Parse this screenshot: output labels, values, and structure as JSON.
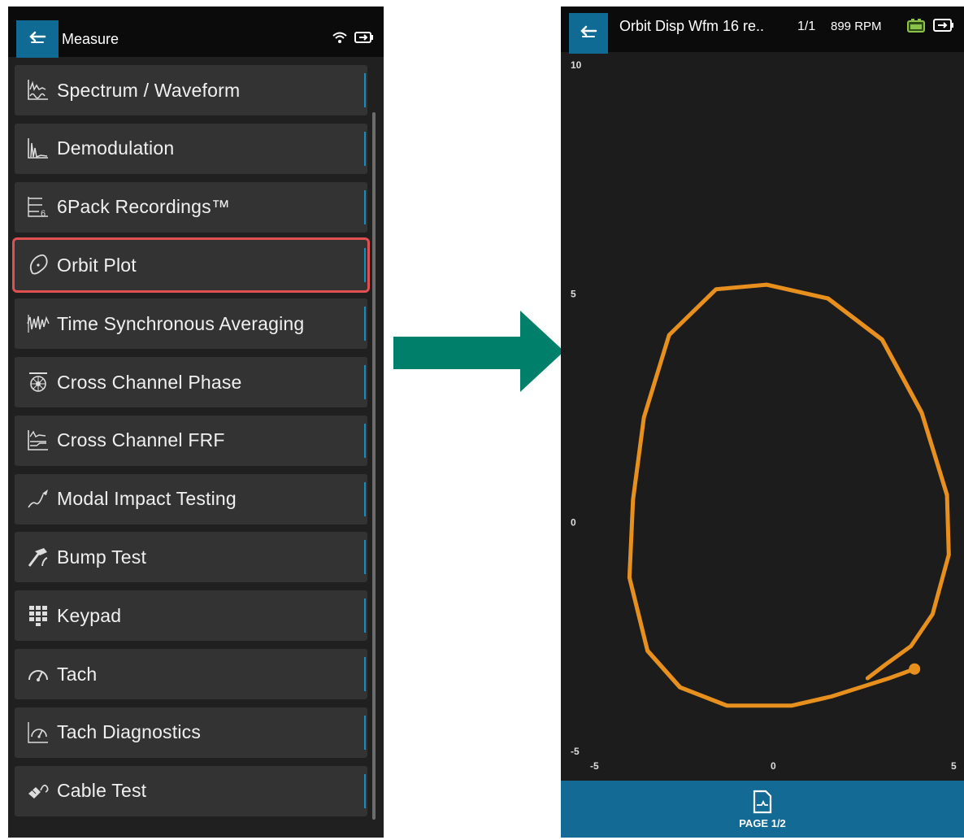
{
  "left_screen": {
    "header": {
      "title": "Measure"
    },
    "menu_items": [
      {
        "label": "Spectrum / Waveform",
        "icon": "spectrum-waveform-icon"
      },
      {
        "label": "Demodulation",
        "icon": "demodulation-icon"
      },
      {
        "label": "6Pack Recordings™",
        "icon": "six-pack-recordings-icon"
      },
      {
        "label": "Orbit Plot",
        "icon": "orbit-plot-icon",
        "selected": true
      },
      {
        "label": "Time Synchronous Averaging",
        "icon": "time-sync-averaging-icon"
      },
      {
        "label": "Cross Channel Phase",
        "icon": "cross-channel-phase-icon"
      },
      {
        "label": "Cross Channel FRF",
        "icon": "cross-channel-frf-icon"
      },
      {
        "label": "Modal Impact Testing",
        "icon": "modal-impact-icon"
      },
      {
        "label": "Bump Test",
        "icon": "bump-test-icon"
      },
      {
        "label": "Keypad",
        "icon": "keypad-icon"
      },
      {
        "label": "Tach",
        "icon": "tach-icon"
      },
      {
        "label": "Tach Diagnostics",
        "icon": "tach-diagnostics-icon"
      },
      {
        "label": "Cable Test",
        "icon": "cable-test-icon"
      }
    ]
  },
  "right_screen": {
    "header": {
      "title": "Orbit Disp Wfm 16 re..",
      "count": "1/1",
      "rpm": "899 RPM"
    },
    "footer": {
      "page_label": "PAGE 1/2"
    }
  },
  "chart_data": {
    "type": "scatter",
    "title": "",
    "xlabel": "",
    "ylabel": "",
    "xlim": [
      -5,
      5
    ],
    "ylim": [
      -5,
      10
    ],
    "x_ticks": [
      "-5",
      "0",
      "5"
    ],
    "y_ticks": [
      "10",
      "5",
      "0",
      "-5"
    ],
    "series": [
      {
        "color": "#e8901e",
        "points": [
          [
            3.9,
            -3.2
          ],
          [
            3.2,
            -3.4
          ],
          [
            1.6,
            -3.8
          ],
          [
            0.5,
            -4.0
          ],
          [
            -1.3,
            -4.0
          ],
          [
            -2.6,
            -3.6
          ],
          [
            -3.5,
            -2.8
          ],
          [
            -4.0,
            -1.2
          ],
          [
            -3.9,
            0.5
          ],
          [
            -3.6,
            2.3
          ],
          [
            -2.9,
            4.1
          ],
          [
            -1.6,
            5.1
          ],
          [
            -0.2,
            5.2
          ],
          [
            1.5,
            4.9
          ],
          [
            3.0,
            4.0
          ],
          [
            4.1,
            2.4
          ],
          [
            4.8,
            0.6
          ],
          [
            4.85,
            -0.7
          ],
          [
            4.4,
            -2.0
          ],
          [
            3.8,
            -2.7
          ],
          [
            3.1,
            -3.1
          ],
          [
            2.6,
            -3.4
          ]
        ]
      }
    ]
  },
  "colors": {
    "accent": "#0f6b93",
    "selection_outline": "#e05050",
    "arrow": "#00806a",
    "orbit": "#e8901e"
  }
}
